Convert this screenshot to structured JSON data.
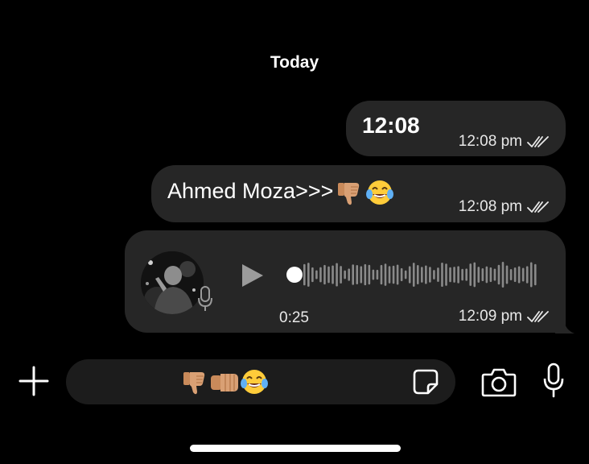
{
  "chat": {
    "date_separator": "Today",
    "messages": [
      {
        "text": "12:08",
        "time": "12:08 pm",
        "status": "read-double-tick"
      },
      {
        "text": "Ahmed Moza>>>",
        "emojis": [
          "thumbs-down-icon",
          "tears-of-joy-icon"
        ],
        "time": "12:08 pm",
        "status": "read-double-tick"
      },
      {
        "type": "voice",
        "duration": "0:25",
        "time": "12:09 pm",
        "status": "read-double-tick",
        "progress": 0
      }
    ]
  },
  "composer": {
    "draft_emojis": [
      "thumbs-down-icon",
      "fist-bump-icon",
      "tears-of-joy-icon"
    ],
    "icons": {
      "add": "plus-icon",
      "sticker": "sticker-icon",
      "camera": "camera-icon",
      "mic": "microphone-icon"
    }
  },
  "colors": {
    "background": "#000000",
    "bubble": "#262626",
    "composer": "#1c1c1c",
    "text": "#ffffff",
    "meta": "#e8e8e8",
    "waveform": "#8a8a8a"
  }
}
